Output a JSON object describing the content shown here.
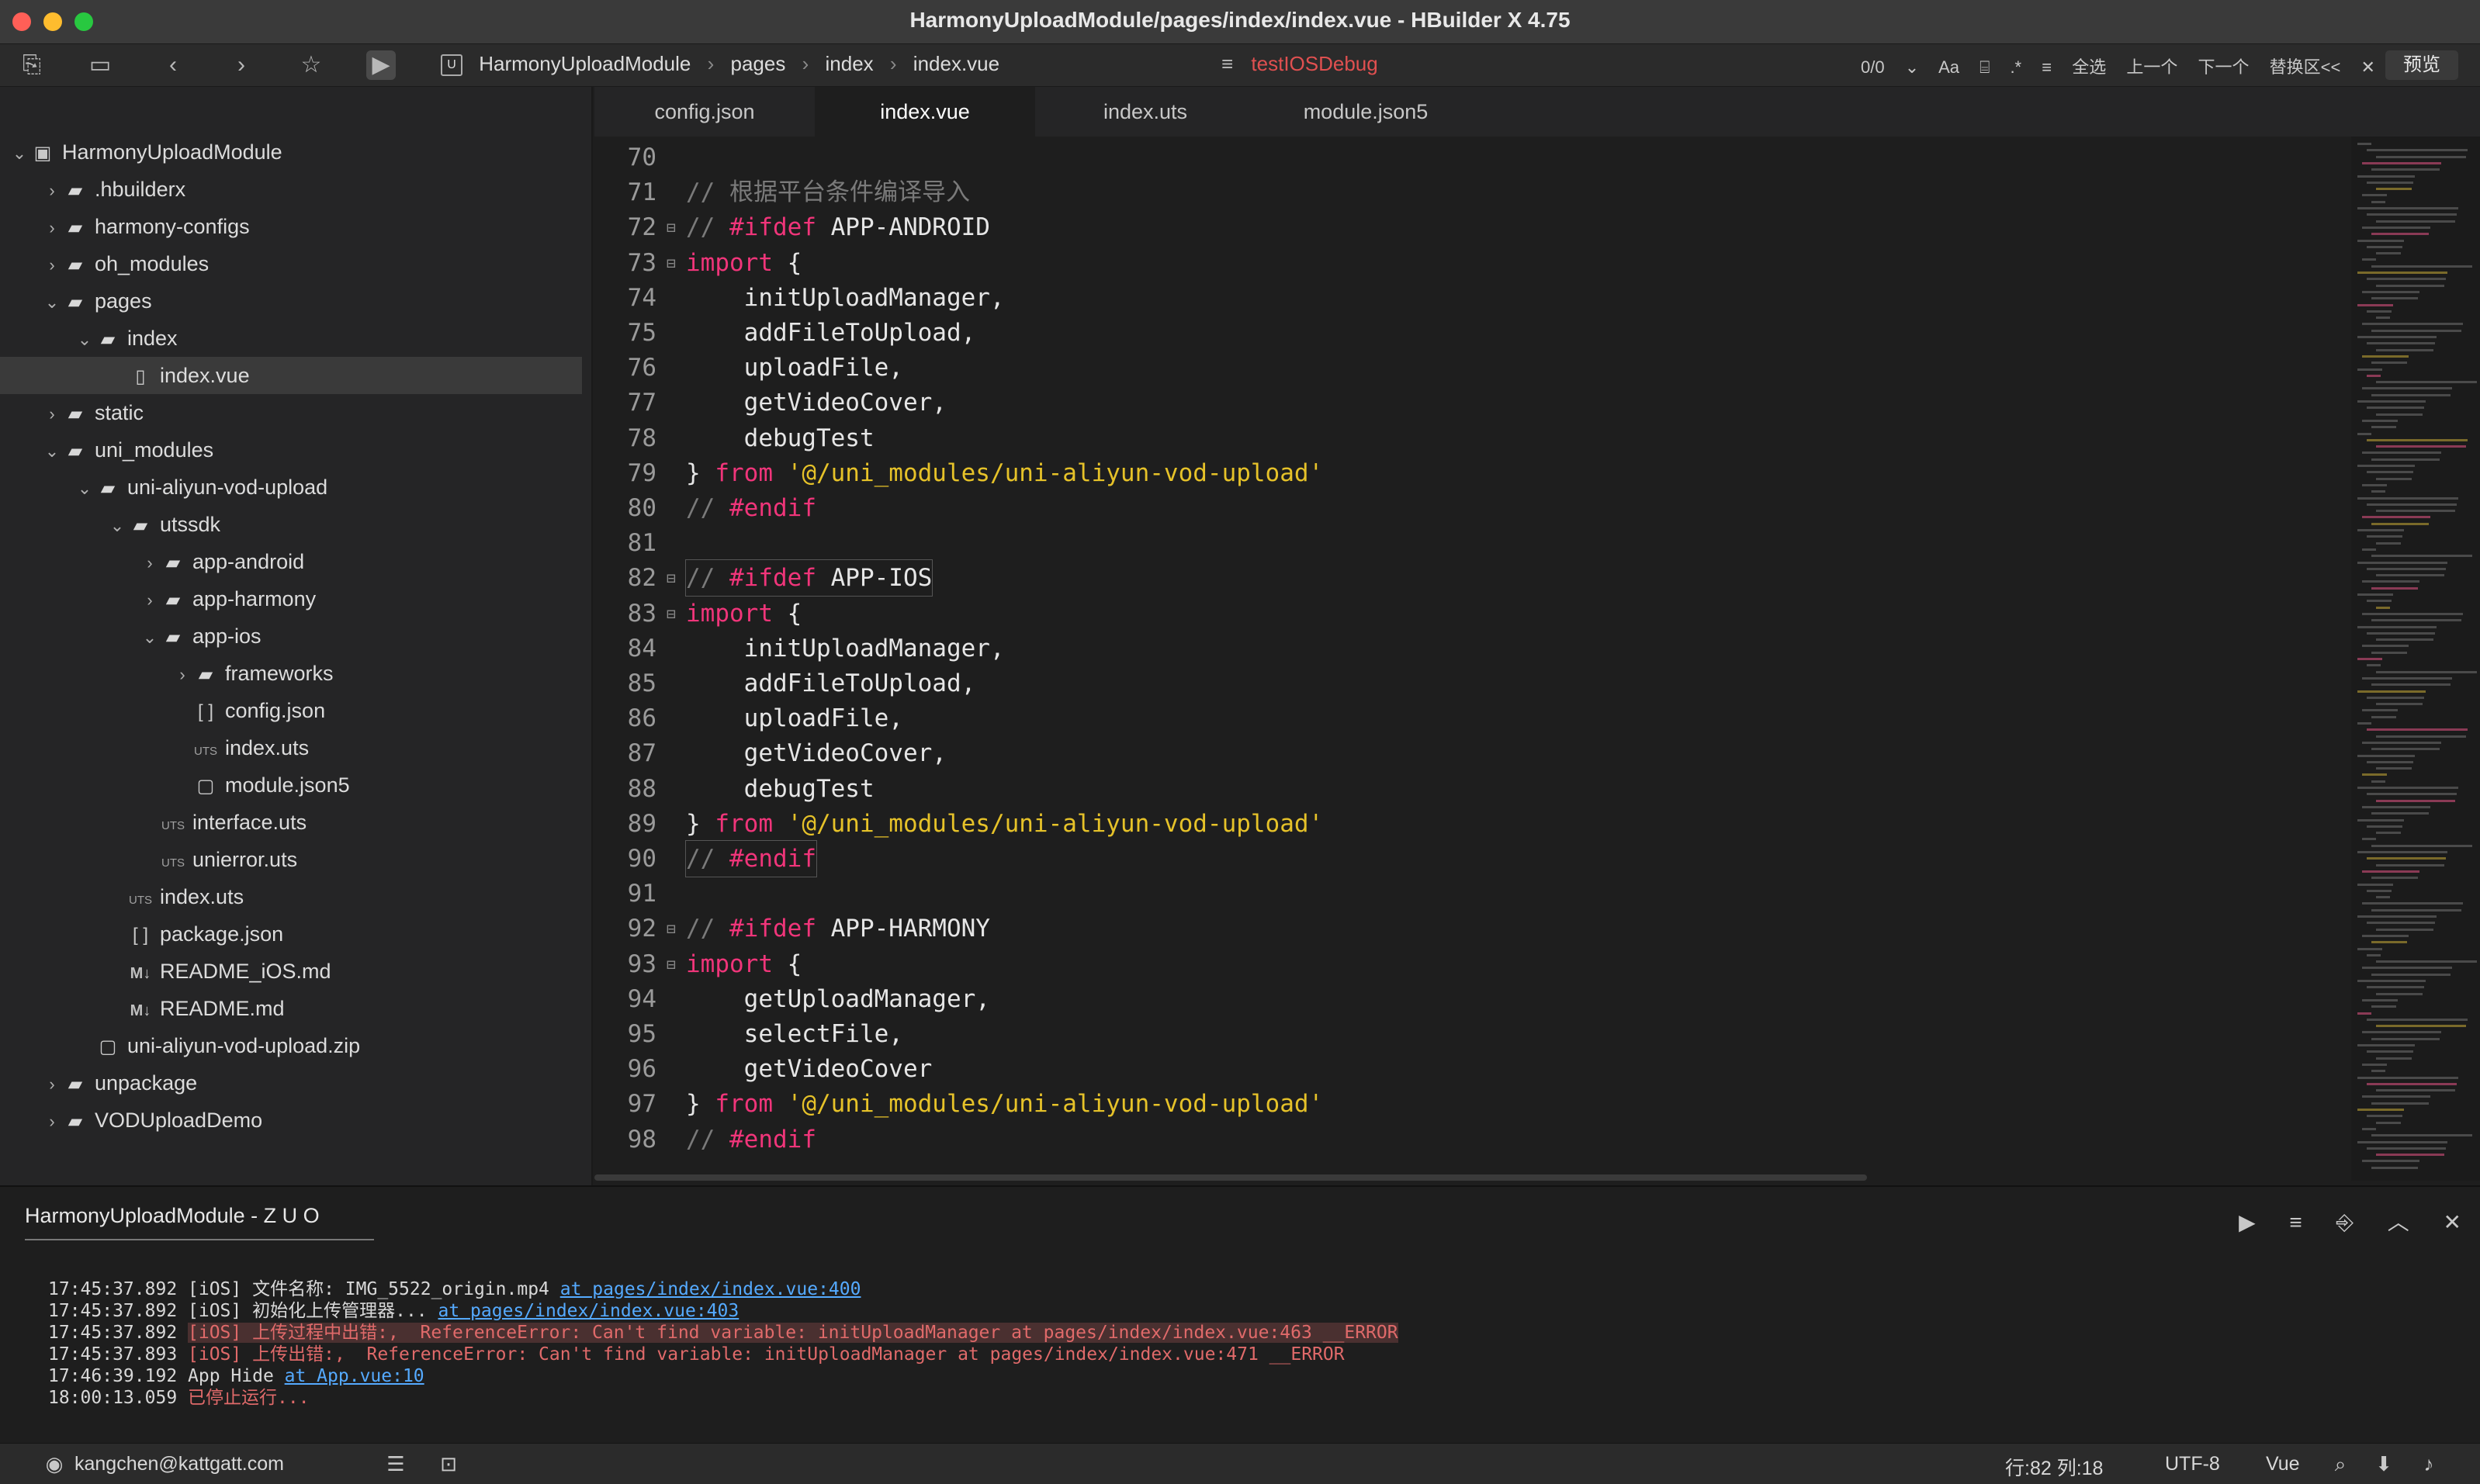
{
  "window": {
    "title": "HarmonyUploadModule/pages/index/index.vue - HBuilder X 4.75"
  },
  "toolbar": {
    "breadcrumb": [
      "HarmonyUploadModule",
      "pages",
      "index",
      "index.vue"
    ],
    "run_config": "testIOSDebug",
    "find_count": "0/0",
    "find_select_all": "全选",
    "find_prev": "上一个",
    "find_next": "下一个",
    "find_replace": "替换区<<",
    "preview": "预览"
  },
  "sidebar": {
    "tree": [
      {
        "label": "HarmonyUploadModule",
        "indent": 0,
        "chevron": "down",
        "icon": "project"
      },
      {
        "label": ".hbuilderx",
        "indent": 1,
        "chevron": "right",
        "icon": "folder"
      },
      {
        "label": "harmony-configs",
        "indent": 1,
        "chevron": "right",
        "icon": "folder"
      },
      {
        "label": "oh_modules",
        "indent": 1,
        "chevron": "right",
        "icon": "folder"
      },
      {
        "label": "pages",
        "indent": 1,
        "chevron": "down",
        "icon": "folder"
      },
      {
        "label": "index",
        "indent": 2,
        "chevron": "down",
        "icon": "folder"
      },
      {
        "label": "index.vue",
        "indent": 3,
        "chevron": "",
        "icon": "vue",
        "selected": true
      },
      {
        "label": "static",
        "indent": 1,
        "chevron": "right",
        "icon": "folder"
      },
      {
        "label": "uni_modules",
        "indent": 1,
        "chevron": "down",
        "icon": "folder"
      },
      {
        "label": "uni-aliyun-vod-upload",
        "indent": 2,
        "chevron": "down",
        "icon": "folder"
      },
      {
        "label": "utssdk",
        "indent": 3,
        "chevron": "down",
        "icon": "folder"
      },
      {
        "label": "app-android",
        "indent": 4,
        "chevron": "right",
        "icon": "folder"
      },
      {
        "label": "app-harmony",
        "indent": 4,
        "chevron": "right",
        "icon": "folder"
      },
      {
        "label": "app-ios",
        "indent": 4,
        "chevron": "down",
        "icon": "folder"
      },
      {
        "label": "frameworks",
        "indent": 5,
        "chevron": "right",
        "icon": "folder"
      },
      {
        "label": "config.json",
        "indent": 5,
        "chevron": "",
        "icon": "json"
      },
      {
        "label": "index.uts",
        "indent": 5,
        "chevron": "",
        "icon": "uts"
      },
      {
        "label": "module.json5",
        "indent": 5,
        "chevron": "",
        "icon": "file"
      },
      {
        "label": "interface.uts",
        "indent": 4,
        "chevron": "",
        "icon": "uts"
      },
      {
        "label": "unierror.uts",
        "indent": 4,
        "chevron": "",
        "icon": "uts"
      },
      {
        "label": "index.uts",
        "indent": 3,
        "chevron": "",
        "icon": "uts"
      },
      {
        "label": "package.json",
        "indent": 3,
        "chevron": "",
        "icon": "json"
      },
      {
        "label": "README_iOS.md",
        "indent": 3,
        "chevron": "",
        "icon": "md"
      },
      {
        "label": "README.md",
        "indent": 3,
        "chevron": "",
        "icon": "md"
      },
      {
        "label": "uni-aliyun-vod-upload.zip",
        "indent": 2,
        "chevron": "",
        "icon": "file"
      },
      {
        "label": "unpackage",
        "indent": 1,
        "chevron": "right",
        "icon": "folder"
      },
      {
        "label": "VODUploadDemo",
        "indent": 1,
        "chevron": "right",
        "icon": "folder"
      }
    ]
  },
  "tabs": [
    {
      "label": "config.json",
      "active": false
    },
    {
      "label": "index.vue",
      "active": true
    },
    {
      "label": "index.uts",
      "active": false
    },
    {
      "label": "module.json5",
      "active": false
    }
  ],
  "editor": {
    "lines": [
      {
        "n": "70",
        "fold": false,
        "tokens": []
      },
      {
        "n": "71",
        "fold": false,
        "tokens": [
          {
            "t": "comment",
            "v": "// 根据平台条件编译导入"
          }
        ]
      },
      {
        "n": "72",
        "fold": true,
        "tokens": [
          {
            "t": "comment",
            "v": "// "
          },
          {
            "t": "kw",
            "v": "#ifdef"
          },
          {
            "t": "plain",
            "v": " APP-ANDROID"
          }
        ]
      },
      {
        "n": "73",
        "fold": true,
        "tokens": [
          {
            "t": "kw",
            "v": "import"
          },
          {
            "t": "plain",
            "v": " {"
          }
        ]
      },
      {
        "n": "74",
        "fold": false,
        "tokens": [
          {
            "t": "plain",
            "v": "    initUploadManager,"
          }
        ]
      },
      {
        "n": "75",
        "fold": false,
        "tokens": [
          {
            "t": "plain",
            "v": "    addFileToUpload,"
          }
        ]
      },
      {
        "n": "76",
        "fold": false,
        "tokens": [
          {
            "t": "plain",
            "v": "    uploadFile,"
          }
        ]
      },
      {
        "n": "77",
        "fold": false,
        "tokens": [
          {
            "t": "plain",
            "v": "    getVideoCover,"
          }
        ]
      },
      {
        "n": "78",
        "fold": false,
        "tokens": [
          {
            "t": "plain",
            "v": "    debugTest"
          }
        ]
      },
      {
        "n": "79",
        "fold": false,
        "tokens": [
          {
            "t": "plain",
            "v": "} "
          },
          {
            "t": "kw",
            "v": "from"
          },
          {
            "t": "plain",
            "v": " "
          },
          {
            "t": "str",
            "v": "'@/uni_modules/uni-aliyun-vod-upload'"
          }
        ]
      },
      {
        "n": "80",
        "fold": false,
        "tokens": [
          {
            "t": "comment",
            "v": "// "
          },
          {
            "t": "kw",
            "v": "#endif"
          }
        ]
      },
      {
        "n": "81",
        "fold": false,
        "tokens": []
      },
      {
        "n": "82",
        "fold": true,
        "boxed": true,
        "tokens": [
          {
            "t": "comment",
            "v": "// "
          },
          {
            "t": "kw",
            "v": "#ifdef"
          },
          {
            "t": "plain",
            "v": " APP-IOS"
          }
        ]
      },
      {
        "n": "83",
        "fold": true,
        "tokens": [
          {
            "t": "kw",
            "v": "import"
          },
          {
            "t": "plain",
            "v": " {"
          }
        ]
      },
      {
        "n": "84",
        "fold": false,
        "tokens": [
          {
            "t": "plain",
            "v": "    initUploadManager,"
          }
        ]
      },
      {
        "n": "85",
        "fold": false,
        "tokens": [
          {
            "t": "plain",
            "v": "    addFileToUpload,"
          }
        ]
      },
      {
        "n": "86",
        "fold": false,
        "tokens": [
          {
            "t": "plain",
            "v": "    uploadFile,"
          }
        ]
      },
      {
        "n": "87",
        "fold": false,
        "tokens": [
          {
            "t": "plain",
            "v": "    getVideoCover,"
          }
        ]
      },
      {
        "n": "88",
        "fold": false,
        "tokens": [
          {
            "t": "plain",
            "v": "    debugTest"
          }
        ]
      },
      {
        "n": "89",
        "fold": false,
        "tokens": [
          {
            "t": "plain",
            "v": "} "
          },
          {
            "t": "kw",
            "v": "from"
          },
          {
            "t": "plain",
            "v": " "
          },
          {
            "t": "str",
            "v": "'@/uni_modules/uni-aliyun-vod-upload'"
          }
        ]
      },
      {
        "n": "90",
        "fold": false,
        "boxed": true,
        "tokens": [
          {
            "t": "comment",
            "v": "// "
          },
          {
            "t": "kw",
            "v": "#endif"
          }
        ]
      },
      {
        "n": "91",
        "fold": false,
        "tokens": []
      },
      {
        "n": "92",
        "fold": true,
        "tokens": [
          {
            "t": "comment",
            "v": "// "
          },
          {
            "t": "kw",
            "v": "#ifdef"
          },
          {
            "t": "plain",
            "v": " APP-HARMONY"
          }
        ]
      },
      {
        "n": "93",
        "fold": true,
        "tokens": [
          {
            "t": "kw",
            "v": "import"
          },
          {
            "t": "plain",
            "v": " {"
          }
        ]
      },
      {
        "n": "94",
        "fold": false,
        "tokens": [
          {
            "t": "plain",
            "v": "    getUploadManager,"
          }
        ]
      },
      {
        "n": "95",
        "fold": false,
        "tokens": [
          {
            "t": "plain",
            "v": "    selectFile,"
          }
        ]
      },
      {
        "n": "96",
        "fold": false,
        "tokens": [
          {
            "t": "plain",
            "v": "    getVideoCover"
          }
        ]
      },
      {
        "n": "97",
        "fold": false,
        "tokens": [
          {
            "t": "plain",
            "v": "} "
          },
          {
            "t": "kw",
            "v": "from"
          },
          {
            "t": "plain",
            "v": " "
          },
          {
            "t": "str",
            "v": "'@/uni_modules/uni-aliyun-vod-upload'"
          }
        ]
      },
      {
        "n": "98",
        "fold": false,
        "tokens": [
          {
            "t": "comment",
            "v": "// "
          },
          {
            "t": "kw",
            "v": "#endif"
          }
        ]
      }
    ]
  },
  "console": {
    "tab_label": "HarmonyUploadModule - Z U O",
    "logs": [
      {
        "parts": [
          {
            "t": "plain",
            "v": "17:45:37.892 [iOS] 文件名称: IMG_5522_origin.mp4 "
          },
          {
            "t": "link",
            "v": "at pages/index/index.vue:400"
          }
        ]
      },
      {
        "parts": [
          {
            "t": "plain",
            "v": "17:45:37.892 [iOS] 初始化上传管理器... "
          },
          {
            "t": "link",
            "v": "at pages/index/index.vue:403"
          }
        ]
      },
      {
        "parts": [
          {
            "t": "plain",
            "v": "17:45:37.892 "
          },
          {
            "t": "errhl",
            "v": "[iOS] 上传过程中出错:,  ReferenceError: Can't find variable: initUploadManager at pages/index/index.vue:463 __ERROR"
          }
        ]
      },
      {
        "parts": [
          {
            "t": "plain",
            "v": "17:45:37.893 "
          },
          {
            "t": "err",
            "v": "[iOS] 上传出错:,  ReferenceError: Can't find variable: initUploadManager at pages/index/index.vue:471 __ERROR"
          }
        ]
      },
      {
        "parts": [
          {
            "t": "plain",
            "v": "17:46:39.192 App Hide "
          },
          {
            "t": "link",
            "v": "at App.vue:10"
          }
        ]
      },
      {
        "parts": [
          {
            "t": "plain",
            "v": "18:00:13.059 "
          },
          {
            "t": "err",
            "v": "已停止运行..."
          }
        ]
      }
    ]
  },
  "statusbar": {
    "user": "kangchen@kattgatt.com",
    "position": "行:82  列:18",
    "encoding": "UTF-8",
    "language": "Vue"
  }
}
